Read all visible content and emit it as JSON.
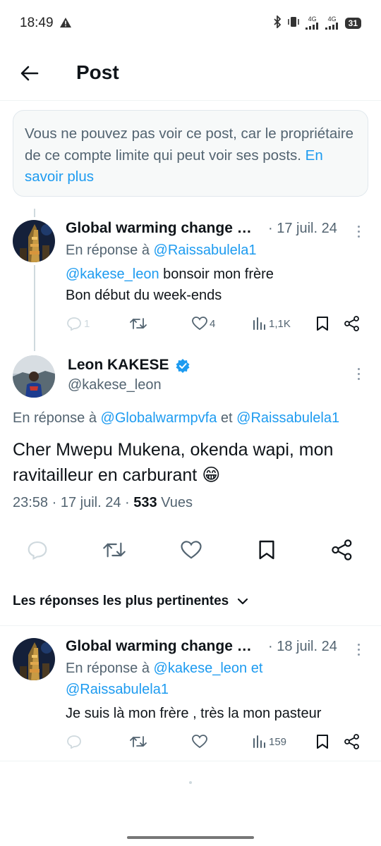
{
  "status": {
    "time": "18:49",
    "battery": "31",
    "network": "4G"
  },
  "header": {
    "title": "Post"
  },
  "notice": {
    "text": "Vous ne pouvez pas voir ce post, car le propriétaire de ce compte limite qui peut voir ses posts.",
    "link": "En savoir plus"
  },
  "parent_tweet": {
    "name": "Global warming change …",
    "date": "· 17 juil. 24",
    "reply_prefix": "En réponse à",
    "reply_handle": "@Raissabulela1",
    "mention": "@kakese_leon",
    "text_line1": " bonsoir mon frère",
    "text_line2": "Bon début du week-ends",
    "replies": "1",
    "likes": "4",
    "views": "1,1K"
  },
  "main_tweet": {
    "name": "Leon KAKESE",
    "handle": "@kakese_leon",
    "reply_prefix": "En réponse à",
    "reply_handle1": "@Globalwarmpvfa",
    "reply_and": "et",
    "reply_handle2": "@Raissabulela1",
    "text": "Cher Mwepu Mukena, okenda wapi, mon ravitailleur en carburant 😁",
    "time": "23:58 · 17 juil. 24 ·",
    "views_count": "533",
    "views_label": "Vues"
  },
  "sort": {
    "label": "Les réponses les plus pertinentes"
  },
  "reply_tweet": {
    "name": "Global warming change …",
    "date": "· 18 juil. 24",
    "reply_prefix": "En réponse à",
    "reply_handle1": "@kakese_leon",
    "reply_and": "et",
    "reply_handle2": "@Raissabulela1",
    "text": "Je suis là mon frère , très la  mon pasteur",
    "views": "159"
  },
  "colors": {
    "accent": "#1d9bf0",
    "muted": "#536471",
    "text": "#0f1419"
  }
}
